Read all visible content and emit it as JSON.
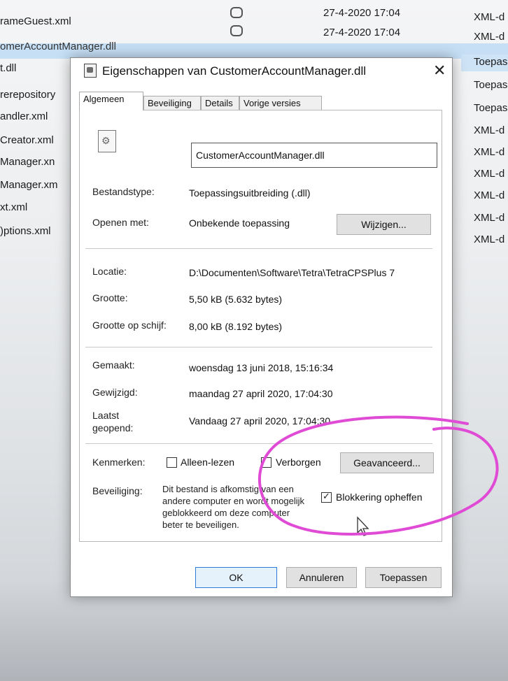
{
  "explorer": {
    "rows": [
      {
        "name": "rameGuest.xml",
        "date": "27-4-2020 17:04",
        "type": "XML-d"
      },
      {
        "name": "omerAccountManager.dll",
        "date": "27-4-2020 17:04",
        "type": "XML-d"
      },
      {
        "name": "t.dll",
        "date": "",
        "type": "Toepas"
      },
      {
        "name": "rerepository",
        "date": "",
        "type": "Toepas"
      },
      {
        "name": "andler.xml",
        "date": "",
        "type": "Toepas"
      },
      {
        "name": "Creator.xml",
        "date": "",
        "type": "XML-d"
      },
      {
        "name": "Manager.xn",
        "date": "",
        "type": "XML-d"
      },
      {
        "name": "Manager.xm",
        "date": "",
        "type": "XML-d"
      },
      {
        "name": "xt.xml",
        "date": "",
        "type": "XML-d"
      },
      {
        "name": ")ptions.xml",
        "date": "",
        "type": "XML-d"
      },
      {
        "name": "",
        "date": "",
        "type": "XML-d"
      }
    ]
  },
  "dialog": {
    "title": "Eigenschappen van CustomerAccountManager.dll",
    "close_symbol": "✕",
    "tabs": [
      {
        "label": "Algemeen"
      },
      {
        "label": "Beveiliging"
      },
      {
        "label": "Details"
      },
      {
        "label": "Vorige versies"
      }
    ],
    "file_name": "CustomerAccountManager.dll",
    "fields": {
      "bestandstype_label": "Bestandstype:",
      "bestandstype_value": "Toepassingsuitbreiding (.dll)",
      "openen_label": "Openen met:",
      "openen_value": "Onbekende toepassing",
      "wijzigen_label": "Wijzigen...",
      "locatie_label": "Locatie:",
      "locatie_value": "D:\\Documenten\\Software\\Tetra\\TetraCPSPlus 7",
      "grootte_label": "Grootte:",
      "grootte_value": "5,50 kB (5.632 bytes)",
      "grootte_schijf_label": "Grootte op schijf:",
      "grootte_schijf_value": "8,00 kB (8.192 bytes)",
      "gemaakt_label": "Gemaakt:",
      "gemaakt_value": "woensdag 13 juni 2018, 15:16:34",
      "gewijzigd_label": "Gewijzigd:",
      "gewijzigd_value": "maandag 27 april 2020, 17:04:30",
      "laatst_label_1": "Laatst",
      "laatst_label_2": "geopend:",
      "laatst_value": "Vandaag 27 april 2020, 17:04:30"
    },
    "attributes": {
      "label": "Kenmerken:",
      "alleen_lezen": "Alleen-lezen",
      "alleen_lezen_checked": false,
      "verborgen": "Verborgen",
      "verborgen_checked": false,
      "geavanceerd": "Geavanceerd..."
    },
    "security": {
      "label": "Beveiliging:",
      "text": "Dit bestand is afkomstig van een andere computer en wordt mogelijk geblokkeerd om deze computer beter te beveiligen.",
      "unblock_label": "Blokkering opheffen",
      "unblock_checked": true
    },
    "buttons": {
      "ok": "OK",
      "cancel": "Annuleren",
      "apply": "Toepassen"
    }
  },
  "annotation_color": "#e04bd6"
}
